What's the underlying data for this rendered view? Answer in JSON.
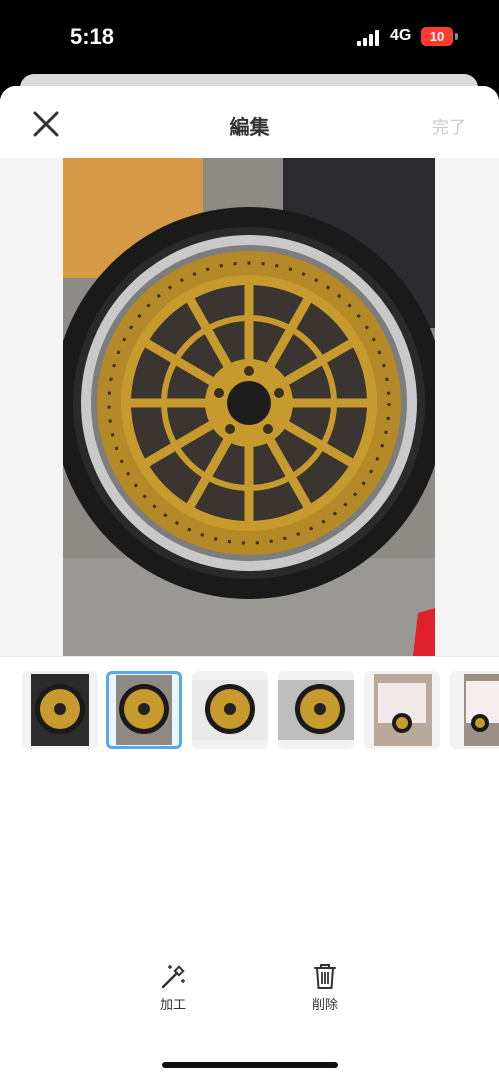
{
  "status_bar": {
    "time": "5:18",
    "network": "4G",
    "battery": "10"
  },
  "nav": {
    "title": "編集",
    "done_label": "完了"
  },
  "thumbnails": [
    {
      "index": 1,
      "selected": false
    },
    {
      "index": 2,
      "selected": true
    },
    {
      "index": 3,
      "selected": false
    },
    {
      "index": 4,
      "selected": false
    },
    {
      "index": 5,
      "selected": false
    },
    {
      "index": 6,
      "selected": false
    }
  ],
  "toolbar": {
    "edit_label": "加工",
    "delete_label": "削除"
  },
  "colors": {
    "accent": "#5aa8e6",
    "done_disabled": "#c9c9c9",
    "wheel_gold": "#c79a2e",
    "battery": "#ff3b30"
  }
}
